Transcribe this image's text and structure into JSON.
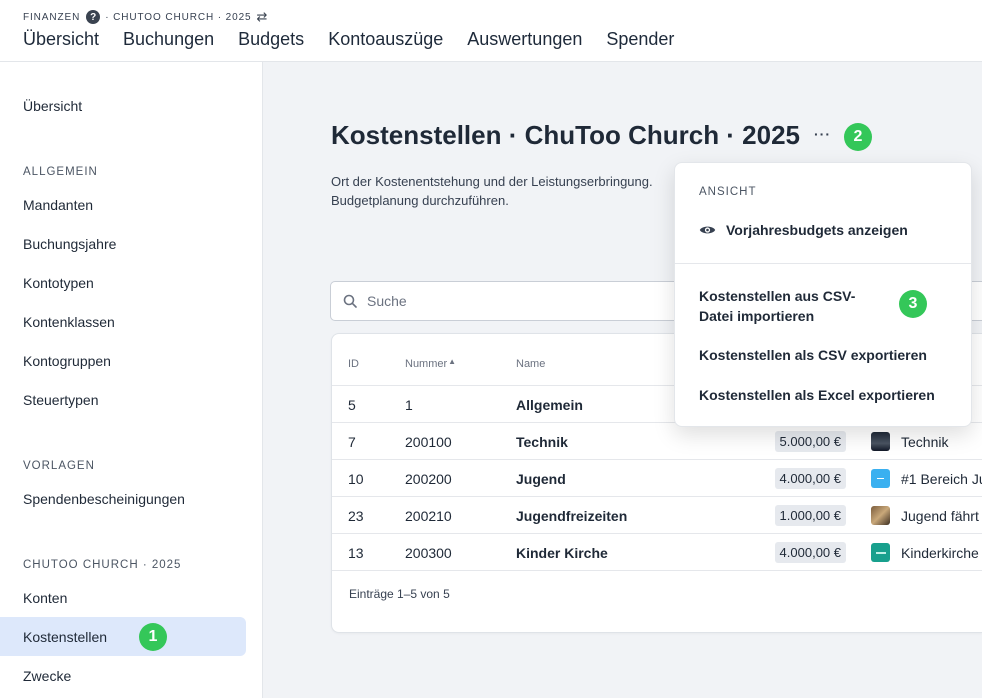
{
  "header": {
    "breadcrumb_section": "FINANZEN",
    "breadcrumb_help": "?",
    "breadcrumb_context": "· CHUTOO CHURCH · 2025",
    "nav": [
      "Übersicht",
      "Buchungen",
      "Budgets",
      "Kontoauszüge",
      "Auswertungen",
      "Spender"
    ]
  },
  "sidebar": {
    "overview": "Übersicht",
    "sections": [
      {
        "title": "ALLGEMEIN",
        "items": [
          "Mandanten",
          "Buchungsjahre",
          "Kontotypen",
          "Kontenklassen",
          "Kontogruppen",
          "Steuertypen"
        ]
      },
      {
        "title": "VORLAGEN",
        "items": [
          "Spendenbescheinigungen"
        ]
      },
      {
        "title": "CHUTOO CHURCH · 2025",
        "items": [
          "Konten",
          "Kostenstellen",
          "Zwecke"
        ]
      }
    ],
    "active_item": "Kostenstellen"
  },
  "main": {
    "title": "Kostenstellen · ChuToo Church · 2025",
    "more_label": "···",
    "description": "Ort der Kostenentstehung und der Leistungserbringung. Budgetplanung durchzuführen.",
    "search_placeholder": "Suche",
    "table": {
      "columns": {
        "id": "ID",
        "number": "Nummer",
        "name": "Name"
      },
      "rows": [
        {
          "id": "5",
          "number": "1",
          "name": "Allgemein",
          "amount": "",
          "group": ""
        },
        {
          "id": "7",
          "number": "200100",
          "name": "Technik",
          "amount": "5.000,00 €",
          "group": "Technik"
        },
        {
          "id": "10",
          "number": "200200",
          "name": "Jugend",
          "amount": "4.000,00 €",
          "group": "#1 Bereich Ju"
        },
        {
          "id": "23",
          "number": "200210",
          "name": "Jugendfreizeiten",
          "amount": "1.000,00 €",
          "group": "Jugend fährt r"
        },
        {
          "id": "13",
          "number": "200300",
          "name": "Kinder Kirche",
          "amount": "4.000,00 €",
          "group": "Kinderkirche"
        }
      ],
      "footer": "Einträge 1–5 von 5"
    }
  },
  "dropdown": {
    "section": "ANSICHT",
    "show_previous": "Vorjahresbudgets anzeigen",
    "import_csv": "Kostenstellen aus CSV-Datei importieren",
    "export_csv": "Kostenstellen als CSV exportieren",
    "export_excel": "Kostenstellen als Excel exportieren"
  },
  "badges": [
    "1",
    "2",
    "3"
  ],
  "colors": {
    "badge_green": "#34c759",
    "active_bg": "#dde8fb",
    "text_dark": "#1f2937"
  }
}
